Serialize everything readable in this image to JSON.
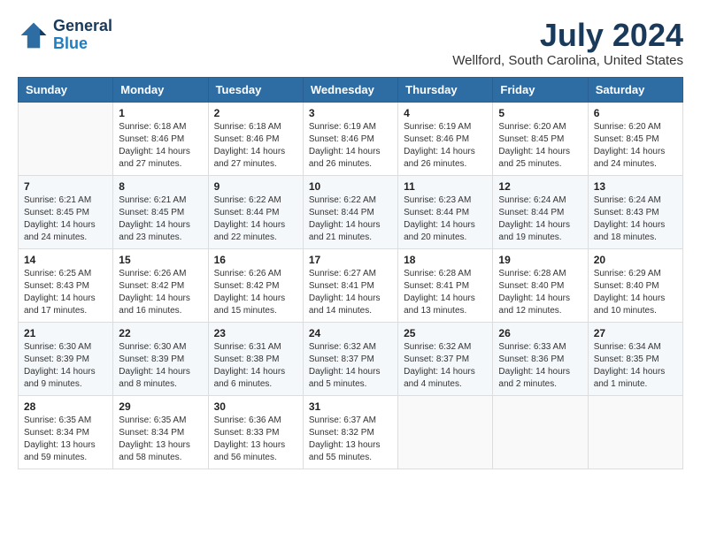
{
  "logo": {
    "line1": "General",
    "line2": "Blue"
  },
  "title": {
    "month_year": "July 2024",
    "location": "Wellford, South Carolina, United States"
  },
  "days_of_week": [
    "Sunday",
    "Monday",
    "Tuesday",
    "Wednesday",
    "Thursday",
    "Friday",
    "Saturday"
  ],
  "weeks": [
    [
      {
        "day": "",
        "sunrise": "",
        "sunset": "",
        "daylight": ""
      },
      {
        "day": "1",
        "sunrise": "Sunrise: 6:18 AM",
        "sunset": "Sunset: 8:46 PM",
        "daylight": "Daylight: 14 hours and 27 minutes."
      },
      {
        "day": "2",
        "sunrise": "Sunrise: 6:18 AM",
        "sunset": "Sunset: 8:46 PM",
        "daylight": "Daylight: 14 hours and 27 minutes."
      },
      {
        "day": "3",
        "sunrise": "Sunrise: 6:19 AM",
        "sunset": "Sunset: 8:46 PM",
        "daylight": "Daylight: 14 hours and 26 minutes."
      },
      {
        "day": "4",
        "sunrise": "Sunrise: 6:19 AM",
        "sunset": "Sunset: 8:46 PM",
        "daylight": "Daylight: 14 hours and 26 minutes."
      },
      {
        "day": "5",
        "sunrise": "Sunrise: 6:20 AM",
        "sunset": "Sunset: 8:45 PM",
        "daylight": "Daylight: 14 hours and 25 minutes."
      },
      {
        "day": "6",
        "sunrise": "Sunrise: 6:20 AM",
        "sunset": "Sunset: 8:45 PM",
        "daylight": "Daylight: 14 hours and 24 minutes."
      }
    ],
    [
      {
        "day": "7",
        "sunrise": "Sunrise: 6:21 AM",
        "sunset": "Sunset: 8:45 PM",
        "daylight": "Daylight: 14 hours and 24 minutes."
      },
      {
        "day": "8",
        "sunrise": "Sunrise: 6:21 AM",
        "sunset": "Sunset: 8:45 PM",
        "daylight": "Daylight: 14 hours and 23 minutes."
      },
      {
        "day": "9",
        "sunrise": "Sunrise: 6:22 AM",
        "sunset": "Sunset: 8:44 PM",
        "daylight": "Daylight: 14 hours and 22 minutes."
      },
      {
        "day": "10",
        "sunrise": "Sunrise: 6:22 AM",
        "sunset": "Sunset: 8:44 PM",
        "daylight": "Daylight: 14 hours and 21 minutes."
      },
      {
        "day": "11",
        "sunrise": "Sunrise: 6:23 AM",
        "sunset": "Sunset: 8:44 PM",
        "daylight": "Daylight: 14 hours and 20 minutes."
      },
      {
        "day": "12",
        "sunrise": "Sunrise: 6:24 AM",
        "sunset": "Sunset: 8:44 PM",
        "daylight": "Daylight: 14 hours and 19 minutes."
      },
      {
        "day": "13",
        "sunrise": "Sunrise: 6:24 AM",
        "sunset": "Sunset: 8:43 PM",
        "daylight": "Daylight: 14 hours and 18 minutes."
      }
    ],
    [
      {
        "day": "14",
        "sunrise": "Sunrise: 6:25 AM",
        "sunset": "Sunset: 8:43 PM",
        "daylight": "Daylight: 14 hours and 17 minutes."
      },
      {
        "day": "15",
        "sunrise": "Sunrise: 6:26 AM",
        "sunset": "Sunset: 8:42 PM",
        "daylight": "Daylight: 14 hours and 16 minutes."
      },
      {
        "day": "16",
        "sunrise": "Sunrise: 6:26 AM",
        "sunset": "Sunset: 8:42 PM",
        "daylight": "Daylight: 14 hours and 15 minutes."
      },
      {
        "day": "17",
        "sunrise": "Sunrise: 6:27 AM",
        "sunset": "Sunset: 8:41 PM",
        "daylight": "Daylight: 14 hours and 14 minutes."
      },
      {
        "day": "18",
        "sunrise": "Sunrise: 6:28 AM",
        "sunset": "Sunset: 8:41 PM",
        "daylight": "Daylight: 14 hours and 13 minutes."
      },
      {
        "day": "19",
        "sunrise": "Sunrise: 6:28 AM",
        "sunset": "Sunset: 8:40 PM",
        "daylight": "Daylight: 14 hours and 12 minutes."
      },
      {
        "day": "20",
        "sunrise": "Sunrise: 6:29 AM",
        "sunset": "Sunset: 8:40 PM",
        "daylight": "Daylight: 14 hours and 10 minutes."
      }
    ],
    [
      {
        "day": "21",
        "sunrise": "Sunrise: 6:30 AM",
        "sunset": "Sunset: 8:39 PM",
        "daylight": "Daylight: 14 hours and 9 minutes."
      },
      {
        "day": "22",
        "sunrise": "Sunrise: 6:30 AM",
        "sunset": "Sunset: 8:39 PM",
        "daylight": "Daylight: 14 hours and 8 minutes."
      },
      {
        "day": "23",
        "sunrise": "Sunrise: 6:31 AM",
        "sunset": "Sunset: 8:38 PM",
        "daylight": "Daylight: 14 hours and 6 minutes."
      },
      {
        "day": "24",
        "sunrise": "Sunrise: 6:32 AM",
        "sunset": "Sunset: 8:37 PM",
        "daylight": "Daylight: 14 hours and 5 minutes."
      },
      {
        "day": "25",
        "sunrise": "Sunrise: 6:32 AM",
        "sunset": "Sunset: 8:37 PM",
        "daylight": "Daylight: 14 hours and 4 minutes."
      },
      {
        "day": "26",
        "sunrise": "Sunrise: 6:33 AM",
        "sunset": "Sunset: 8:36 PM",
        "daylight": "Daylight: 14 hours and 2 minutes."
      },
      {
        "day": "27",
        "sunrise": "Sunrise: 6:34 AM",
        "sunset": "Sunset: 8:35 PM",
        "daylight": "Daylight: 14 hours and 1 minute."
      }
    ],
    [
      {
        "day": "28",
        "sunrise": "Sunrise: 6:35 AM",
        "sunset": "Sunset: 8:34 PM",
        "daylight": "Daylight: 13 hours and 59 minutes."
      },
      {
        "day": "29",
        "sunrise": "Sunrise: 6:35 AM",
        "sunset": "Sunset: 8:34 PM",
        "daylight": "Daylight: 13 hours and 58 minutes."
      },
      {
        "day": "30",
        "sunrise": "Sunrise: 6:36 AM",
        "sunset": "Sunset: 8:33 PM",
        "daylight": "Daylight: 13 hours and 56 minutes."
      },
      {
        "day": "31",
        "sunrise": "Sunrise: 6:37 AM",
        "sunset": "Sunset: 8:32 PM",
        "daylight": "Daylight: 13 hours and 55 minutes."
      },
      {
        "day": "",
        "sunrise": "",
        "sunset": "",
        "daylight": ""
      },
      {
        "day": "",
        "sunrise": "",
        "sunset": "",
        "daylight": ""
      },
      {
        "day": "",
        "sunrise": "",
        "sunset": "",
        "daylight": ""
      }
    ]
  ]
}
